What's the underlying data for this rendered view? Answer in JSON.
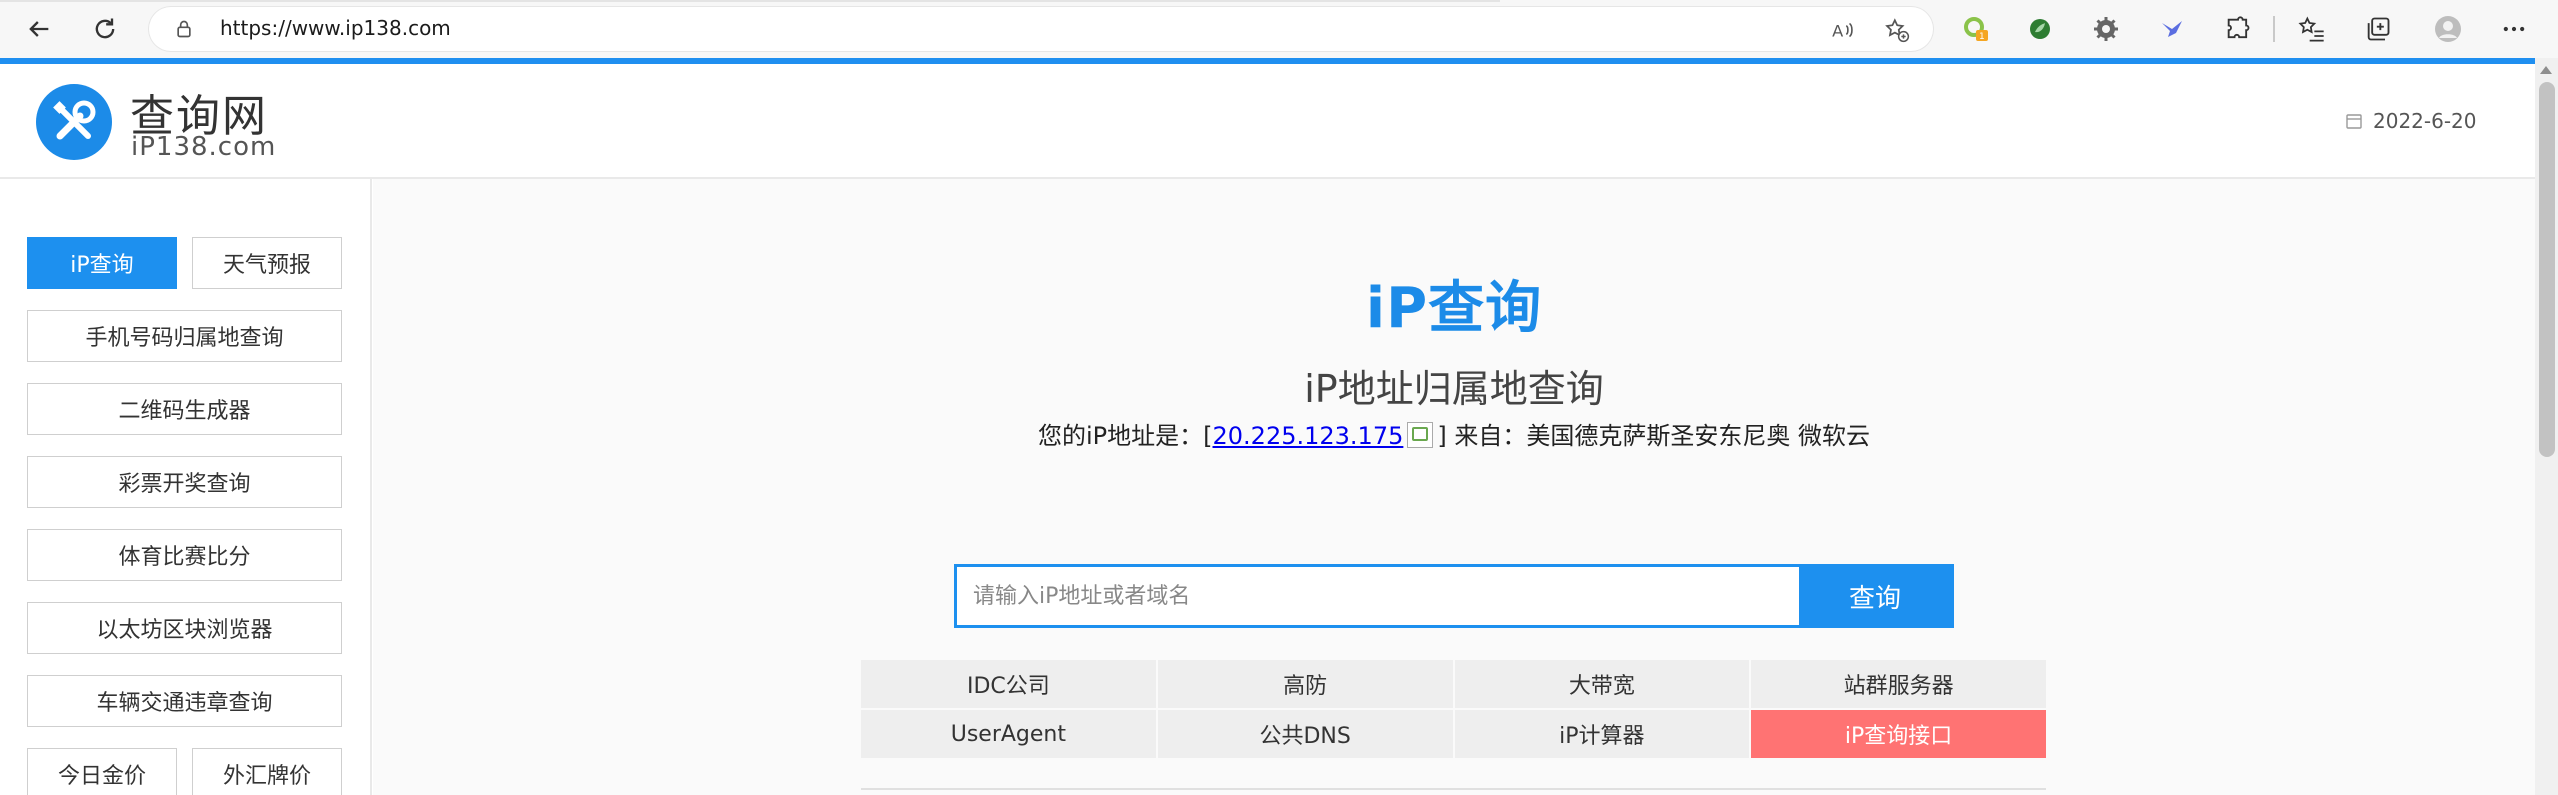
{
  "browser": {
    "url": "https://www.ip138.com",
    "extension_badge": "1"
  },
  "site": {
    "logo_title": "查询网",
    "logo_subtitle": "iP138.com",
    "date": "2022-6-20"
  },
  "sidebar": {
    "items": [
      {
        "label": "iP查询",
        "active": true
      },
      {
        "label": "天气预报"
      },
      {
        "label": "手机号码归属地查询"
      },
      {
        "label": "二维码生成器"
      },
      {
        "label": "彩票开奖查询"
      },
      {
        "label": "体育比赛比分"
      },
      {
        "label": "以太坊区块浏览器"
      },
      {
        "label": "车辆交通违章查询"
      },
      {
        "label": "今日金价"
      },
      {
        "label": "外汇牌价"
      }
    ]
  },
  "main": {
    "title": "iP查询",
    "subtitle": "iP地址归属地查询",
    "ip_prefix": "您的iP地址是：[",
    "ip_address": "20.225.123.175",
    "ip_suffix": "] 来自：美国德克萨斯圣安东尼奥 微软云",
    "search": {
      "placeholder": "请输入iP地址或者域名",
      "value": "",
      "button_label": "查询"
    },
    "links": [
      {
        "label": "IDC公司"
      },
      {
        "label": "高防"
      },
      {
        "label": "大带宽"
      },
      {
        "label": "站群服务器"
      },
      {
        "label": "UserAgent"
      },
      {
        "label": "公共DNS"
      },
      {
        "label": "iP计算器"
      },
      {
        "label": "iP查询接口",
        "highlight": true
      }
    ]
  },
  "colors": {
    "accent": "#1d90ef",
    "highlight": "#ff7373"
  }
}
